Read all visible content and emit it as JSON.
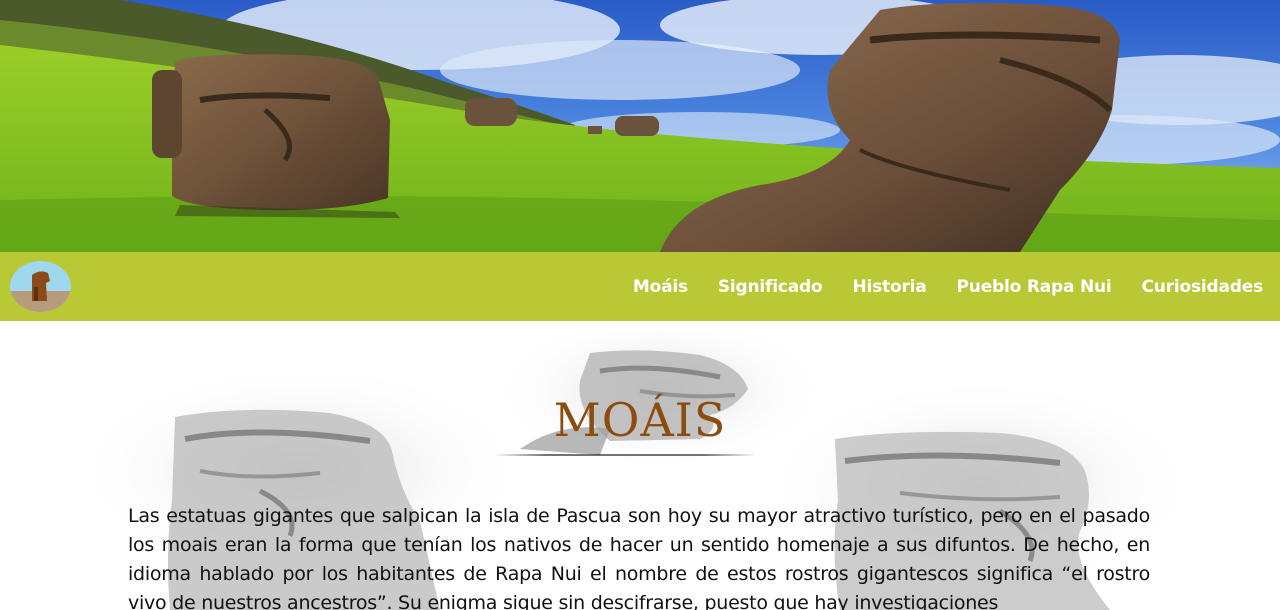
{
  "hero": {
    "image": "easter-island-moai-hillside-photo"
  },
  "navbar": {
    "logo": "moai-logo-icon",
    "links": [
      {
        "label": "Moáis"
      },
      {
        "label": "Significado"
      },
      {
        "label": "Historia"
      },
      {
        "label": "Pueblo Rapa Nui"
      },
      {
        "label": "Curiosidades"
      }
    ],
    "background_color": "#b8c935"
  },
  "main": {
    "title": "MOÁIS",
    "title_color": "#8b4c12",
    "background_art": "moai-sketch-illustration",
    "paragraph": "Las estatuas gigantes que salpican la isla de Pascua son hoy su mayor atractivo turístico, pero en el pasado los moais eran la forma que tenían los nativos de hacer un sentido homenaje a sus difuntos. De hecho, en idioma hablado por los habitantes de Rapa Nui el nombre de estos rostros gigantescos significa “el rostro vivo de nuestros ancestros”. Su enigma sigue sin descifrarse, puesto que hay investigaciones"
  }
}
